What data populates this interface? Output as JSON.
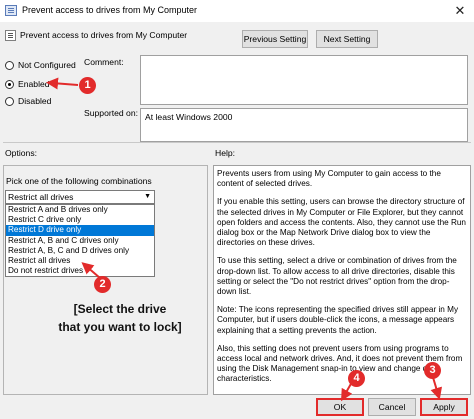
{
  "window": {
    "title": "Prevent access to drives from My Computer",
    "close_glyph": "✕"
  },
  "policy": {
    "name": "Prevent access to drives from My Computer"
  },
  "nav": {
    "previous_label": "Previous Setting",
    "next_label": "Next Setting"
  },
  "state": {
    "options": [
      {
        "label": "Not Configured",
        "selected": false
      },
      {
        "label": "Enabled",
        "selected": true
      },
      {
        "label": "Disabled",
        "selected": false
      }
    ]
  },
  "comment": {
    "label": "Comment:",
    "value": ""
  },
  "supported": {
    "label": "Supported on:",
    "value": "At least Windows 2000"
  },
  "options_section": {
    "label": "Options:",
    "pick_label": "Pick one of the following combinations",
    "selected": "Restrict all drives",
    "items": [
      "Restrict A and B drives only",
      "Restrict C drive only",
      "Restrict D drive only",
      "Restrict A, B and C drives only",
      "Restrict A, B, C and D drives only",
      "Restrict all drives",
      "Do not restrict drives"
    ],
    "highlighted_index": 2
  },
  "help": {
    "label": "Help:",
    "paragraphs": [
      "Prevents users from using My Computer to gain access to the content of selected drives.",
      "If you enable this setting, users can browse the directory structure of the selected drives in My Computer or File Explorer, but they cannot open folders and access the contents. Also, they cannot use the Run dialog box or the Map Network Drive dialog box to view the directories on these drives.",
      "To use this setting, select a drive or combination of drives from the drop-down list. To allow access to all drive directories, disable this setting or select the \"Do not restrict drives\" option from the drop-down list.",
      "Note: The icons representing the specified drives still appear in My Computer, but if users double-click the icons, a message appears explaining that a setting prevents the action.",
      "Also, this setting does not prevent users from using programs to access local and network drives. And, it does not prevent them from using the Disk Management snap-in to view and change drive characteristics."
    ]
  },
  "annotations": {
    "badge1": "1",
    "badge2": "2",
    "badge3": "3",
    "badge4": "4",
    "caption_line1": "[Select the drive",
    "caption_line2": "that you want to lock]",
    "accent_color": "#e22b2b"
  },
  "footer": {
    "ok_label": "OK",
    "cancel_label": "Cancel",
    "apply_label": "Apply"
  }
}
